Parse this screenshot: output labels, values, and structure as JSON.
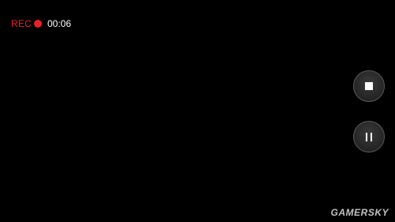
{
  "recording": {
    "label": "REC",
    "elapsed": "00:06"
  },
  "controls": {
    "stop_icon": "stop-icon",
    "pause_icon": "pause-icon"
  },
  "watermark": {
    "text": "GAMERSKY"
  },
  "colors": {
    "background": "#000000",
    "rec_red": "#e8202a"
  }
}
